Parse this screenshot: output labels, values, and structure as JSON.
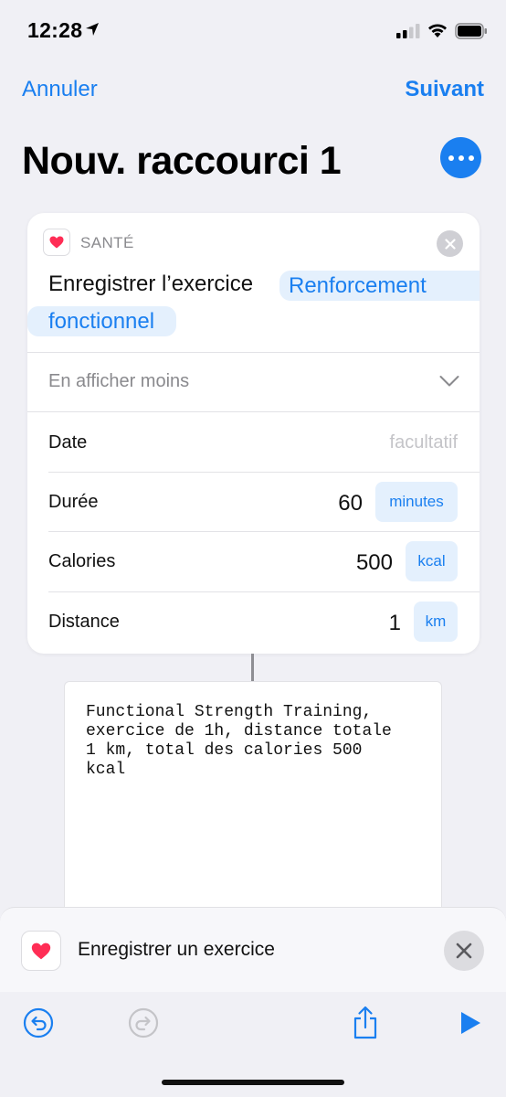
{
  "status_bar": {
    "time": "12:28"
  },
  "nav": {
    "cancel_label": "Annuler",
    "next_label": "Suivant"
  },
  "title": "Nouv. raccourci 1",
  "action_card": {
    "app_label": "SANTÉ",
    "action_text": "Enregistrer l’exercice",
    "workout_type_line1": "Renforcement",
    "workout_type_line2": "fonctionnel",
    "show_less_label": "En afficher moins",
    "date": {
      "label": "Date",
      "placeholder": "facultatif"
    },
    "duration": {
      "label": "Durée",
      "value": "60",
      "unit": "minutes"
    },
    "calories": {
      "label": "Calories",
      "value": "500",
      "unit": "kcal"
    },
    "distance": {
      "label": "Distance",
      "value": "1",
      "unit": "km"
    }
  },
  "output_text": "Functional Strength Training,\nexercice de 1h, distance totale\n1 km, total des calories 500\nkcal",
  "bottom_sheet": {
    "label": "Enregistrer un exercice"
  },
  "colors": {
    "accent": "#1a7ff0",
    "heart": "#ff2d55",
    "background": "#f0f0f5"
  }
}
